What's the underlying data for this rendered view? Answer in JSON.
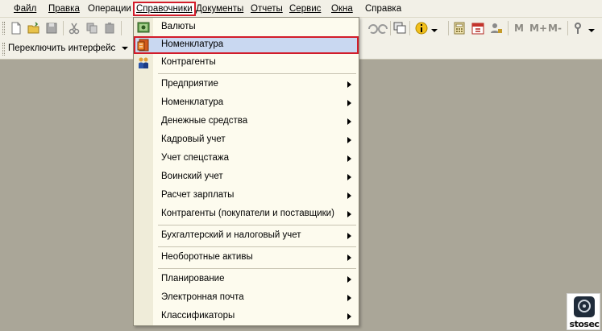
{
  "menubar": {
    "items": [
      "Файл",
      "Правка",
      "Операции",
      "Справочники",
      "Документы",
      "Отчеты",
      "Сервис",
      "Окна",
      "Справка"
    ],
    "active": "Справочники"
  },
  "toolbar": {
    "m_buttons": [
      "M",
      "M+",
      "M-"
    ]
  },
  "interface_switch": {
    "label": "Переключить интерфейс"
  },
  "dropdown": {
    "items": [
      {
        "label": "Валюты",
        "icon": "currency-icon",
        "submenu": false
      },
      {
        "label": "Номенклатура",
        "icon": "nomenclature-icon",
        "submenu": false,
        "highlighted": true
      },
      {
        "label": "Контрагенты",
        "icon": "counterparties-icon",
        "submenu": false
      },
      {
        "label": "Предприятие",
        "submenu": true
      },
      {
        "label": "Номенклатура",
        "submenu": true
      },
      {
        "label": "Денежные средства",
        "submenu": true
      },
      {
        "label": "Кадровый учет",
        "submenu": true
      },
      {
        "label": "Учет спецстажа",
        "submenu": true
      },
      {
        "label": "Воинский учет",
        "submenu": true
      },
      {
        "label": "Расчет зарплаты",
        "submenu": true
      },
      {
        "label": "Контрагенты (покупатели и поставщики)",
        "submenu": true
      },
      {
        "label": "Бухгалтерский и налоговый учет",
        "submenu": true
      },
      {
        "label": "Необоротные активы",
        "submenu": true
      },
      {
        "label": "Планирование",
        "submenu": true
      },
      {
        "label": "Электронная почта",
        "submenu": true
      },
      {
        "label": "Классификаторы",
        "submenu": true
      }
    ]
  },
  "watermark": {
    "text": "stosec"
  },
  "colors": {
    "highlight_border": "#d21c2a",
    "highlight_fill": "#c9d8f1",
    "menu_bg": "#fdfbee",
    "workspace": "#aaa698"
  }
}
